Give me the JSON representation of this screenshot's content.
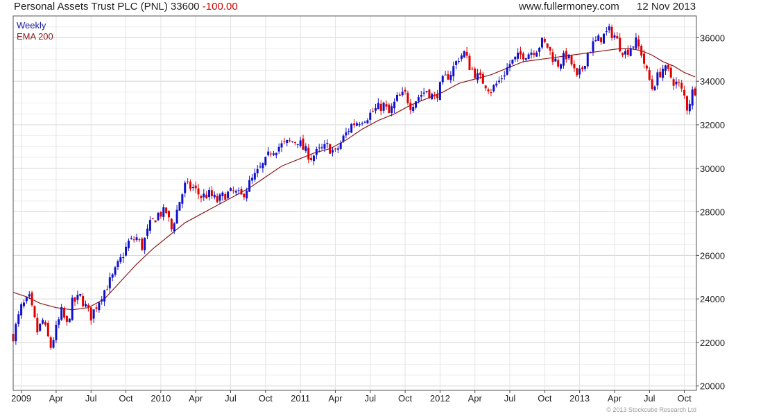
{
  "header": {
    "name": "Personal Assets Trust PLC (PNL) 33600",
    "change": "-100.00",
    "site": "www.fullermoney.com",
    "date": "12 Nov 2013"
  },
  "legend": {
    "interval": "Weekly",
    "ema": "EMA 200"
  },
  "copyright": "© 2013 Stockcube Research Ltd",
  "colors": {
    "up": "#1010cc",
    "down": "#e00000",
    "ema": "#8b1a1a",
    "grid": "#e6e6e6",
    "axis": "#444444"
  },
  "chart_data": {
    "type": "candlestick",
    "interval": "Weekly",
    "ylim": [
      19800,
      37000
    ],
    "yticks": [
      20000,
      22000,
      24000,
      26000,
      28000,
      30000,
      32000,
      34000,
      36000
    ],
    "x_range_weeks": [
      0,
      254.5
    ],
    "xticks": [
      {
        "label": "2009",
        "week": 3
      },
      {
        "label": "Apr",
        "week": 16
      },
      {
        "label": "Jul",
        "week": 29
      },
      {
        "label": "Oct",
        "week": 42
      },
      {
        "label": "2010",
        "week": 55
      },
      {
        "label": "Apr",
        "week": 68
      },
      {
        "label": "Jul",
        "week": 81
      },
      {
        "label": "Oct",
        "week": 94
      },
      {
        "label": "2011",
        "week": 107
      },
      {
        "label": "Apr",
        "week": 120
      },
      {
        "label": "Jul",
        "week": 133
      },
      {
        "label": "Oct",
        "week": 146
      },
      {
        "label": "2012",
        "week": 159
      },
      {
        "label": "Apr",
        "week": 172
      },
      {
        "label": "Jul",
        "week": 185
      },
      {
        "label": "Oct",
        "week": 198
      },
      {
        "label": "2013",
        "week": 211
      },
      {
        "label": "Apr",
        "week": 224
      },
      {
        "label": "Jul",
        "week": 237
      },
      {
        "label": "Oct",
        "week": 250
      }
    ],
    "close_path": [
      [
        0,
        22300
      ],
      [
        3,
        23600
      ],
      [
        6,
        24000
      ],
      [
        9,
        22500
      ],
      [
        11,
        23000
      ],
      [
        14,
        21800
      ],
      [
        16,
        22600
      ],
      [
        18,
        23400
      ],
      [
        20,
        22800
      ],
      [
        22,
        23800
      ],
      [
        25,
        24100
      ],
      [
        29,
        23200
      ],
      [
        33,
        24200
      ],
      [
        37,
        25000
      ],
      [
        40,
        25800
      ],
      [
        43,
        26600
      ],
      [
        46,
        26800
      ],
      [
        48,
        26400
      ],
      [
        51,
        27400
      ],
      [
        54,
        27900
      ],
      [
        57,
        28000
      ],
      [
        59,
        27200
      ],
      [
        62,
        28500
      ],
      [
        64,
        29200
      ],
      [
        67,
        29100
      ],
      [
        70,
        28700
      ],
      [
        73,
        28800
      ],
      [
        76,
        28500
      ],
      [
        79,
        28800
      ],
      [
        82,
        28900
      ],
      [
        85,
        28700
      ],
      [
        88,
        29300
      ],
      [
        91,
        29800
      ],
      [
        94,
        30300
      ],
      [
        96,
        30800
      ],
      [
        99,
        31000
      ],
      [
        103,
        31200
      ],
      [
        106,
        31300
      ],
      [
        108,
        30900
      ],
      [
        111,
        30500
      ],
      [
        114,
        30800
      ],
      [
        117,
        31000
      ],
      [
        120,
        30700
      ],
      [
        123,
        31400
      ],
      [
        126,
        32000
      ],
      [
        129,
        32200
      ],
      [
        132,
        32400
      ],
      [
        135,
        32700
      ],
      [
        138,
        32900
      ],
      [
        140,
        32500
      ],
      [
        143,
        33200
      ],
      [
        146,
        33400
      ],
      [
        148,
        32900
      ],
      [
        151,
        33300
      ],
      [
        154,
        33600
      ],
      [
        157,
        33200
      ],
      [
        160,
        34000
      ],
      [
        163,
        34400
      ],
      [
        166,
        35100
      ],
      [
        168,
        35300
      ],
      [
        170,
        34700
      ],
      [
        173,
        34200
      ],
      [
        175,
        34000
      ],
      [
        178,
        33600
      ],
      [
        181,
        34000
      ],
      [
        183,
        34400
      ],
      [
        185,
        34800
      ],
      [
        187,
        35000
      ],
      [
        189,
        35200
      ],
      [
        192,
        35300
      ],
      [
        195,
        35500
      ],
      [
        197,
        35800
      ],
      [
        199,
        35600
      ],
      [
        201,
        35100
      ],
      [
        203,
        34800
      ],
      [
        206,
        35200
      ],
      [
        208,
        34800
      ],
      [
        210,
        34100
      ],
      [
        212,
        34600
      ],
      [
        214,
        35300
      ],
      [
        216,
        35700
      ],
      [
        219,
        36000
      ],
      [
        222,
        36300
      ],
      [
        224,
        36100
      ],
      [
        226,
        35600
      ],
      [
        228,
        35300
      ],
      [
        230,
        35600
      ],
      [
        232,
        35800
      ],
      [
        234,
        35300
      ],
      [
        236,
        34400
      ],
      [
        238,
        33700
      ],
      [
        240,
        34200
      ],
      [
        242,
        34600
      ],
      [
        244,
        34400
      ],
      [
        246,
        34000
      ],
      [
        248,
        33800
      ],
      [
        250,
        33300
      ],
      [
        251,
        32800
      ],
      [
        252,
        33100
      ],
      [
        253,
        33500
      ],
      [
        254,
        33600
      ]
    ],
    "ema_200": [
      [
        0,
        24300
      ],
      [
        5,
        24100
      ],
      [
        10,
        23800
      ],
      [
        16,
        23600
      ],
      [
        22,
        23500
      ],
      [
        28,
        23600
      ],
      [
        34,
        24000
      ],
      [
        40,
        24800
      ],
      [
        46,
        25600
      ],
      [
        52,
        26300
      ],
      [
        58,
        26900
      ],
      [
        64,
        27500
      ],
      [
        70,
        27900
      ],
      [
        76,
        28300
      ],
      [
        82,
        28700
      ],
      [
        88,
        29100
      ],
      [
        94,
        29600
      ],
      [
        100,
        30100
      ],
      [
        106,
        30400
      ],
      [
        112,
        30700
      ],
      [
        118,
        30900
      ],
      [
        124,
        31300
      ],
      [
        130,
        31800
      ],
      [
        136,
        32200
      ],
      [
        142,
        32500
      ],
      [
        148,
        32900
      ],
      [
        154,
        33200
      ],
      [
        160,
        33500
      ],
      [
        166,
        33900
      ],
      [
        172,
        34100
      ],
      [
        178,
        34300
      ],
      [
        184,
        34600
      ],
      [
        190,
        34900
      ],
      [
        196,
        35000
      ],
      [
        202,
        35100
      ],
      [
        208,
        35200
      ],
      [
        214,
        35300
      ],
      [
        220,
        35400
      ],
      [
        226,
        35500
      ],
      [
        230,
        35500
      ],
      [
        234,
        35400
      ],
      [
        238,
        35200
      ],
      [
        242,
        34900
      ],
      [
        246,
        34700
      ],
      [
        250,
        34400
      ],
      [
        254,
        34200
      ]
    ],
    "last_close": 33600,
    "change": -100.0
  }
}
